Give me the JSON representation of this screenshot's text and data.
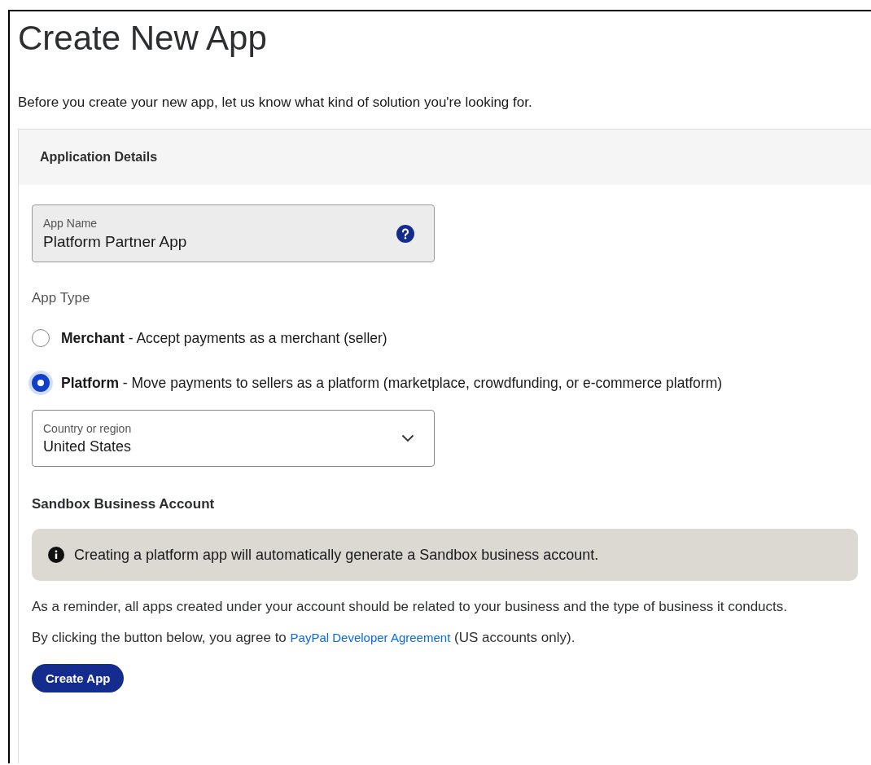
{
  "title": "Create New App",
  "intro": "Before you create your new app, let us know what kind of solution you're looking for.",
  "card": {
    "header": "Application Details",
    "app_name": {
      "label": "App Name",
      "value": "Platform Partner App"
    },
    "app_type": {
      "label": "App Type",
      "options": [
        {
          "text": "**Merchant** - Accept payments as a merchant (seller)",
          "selected": false
        },
        {
          "text": "**Platform** - Move payments to sellers as a platform (marketplace, crowdfunding, or e-commerce platform)",
          "selected": true
        }
      ]
    },
    "country": {
      "label": "Country or region",
      "value": "United States"
    },
    "sandbox": {
      "heading": "Sandbox Business Account",
      "notice": "Creating a platform app will automatically generate a Sandbox business account."
    },
    "reminder": "As a reminder, all apps created under your account should be related to your business and the type of business it conducts.",
    "agreement": {
      "before": "By clicking the button below, you agree to",
      "link": "PayPal Developer Agreement",
      "after": "(US accounts only)."
    },
    "button": "Create App"
  }
}
